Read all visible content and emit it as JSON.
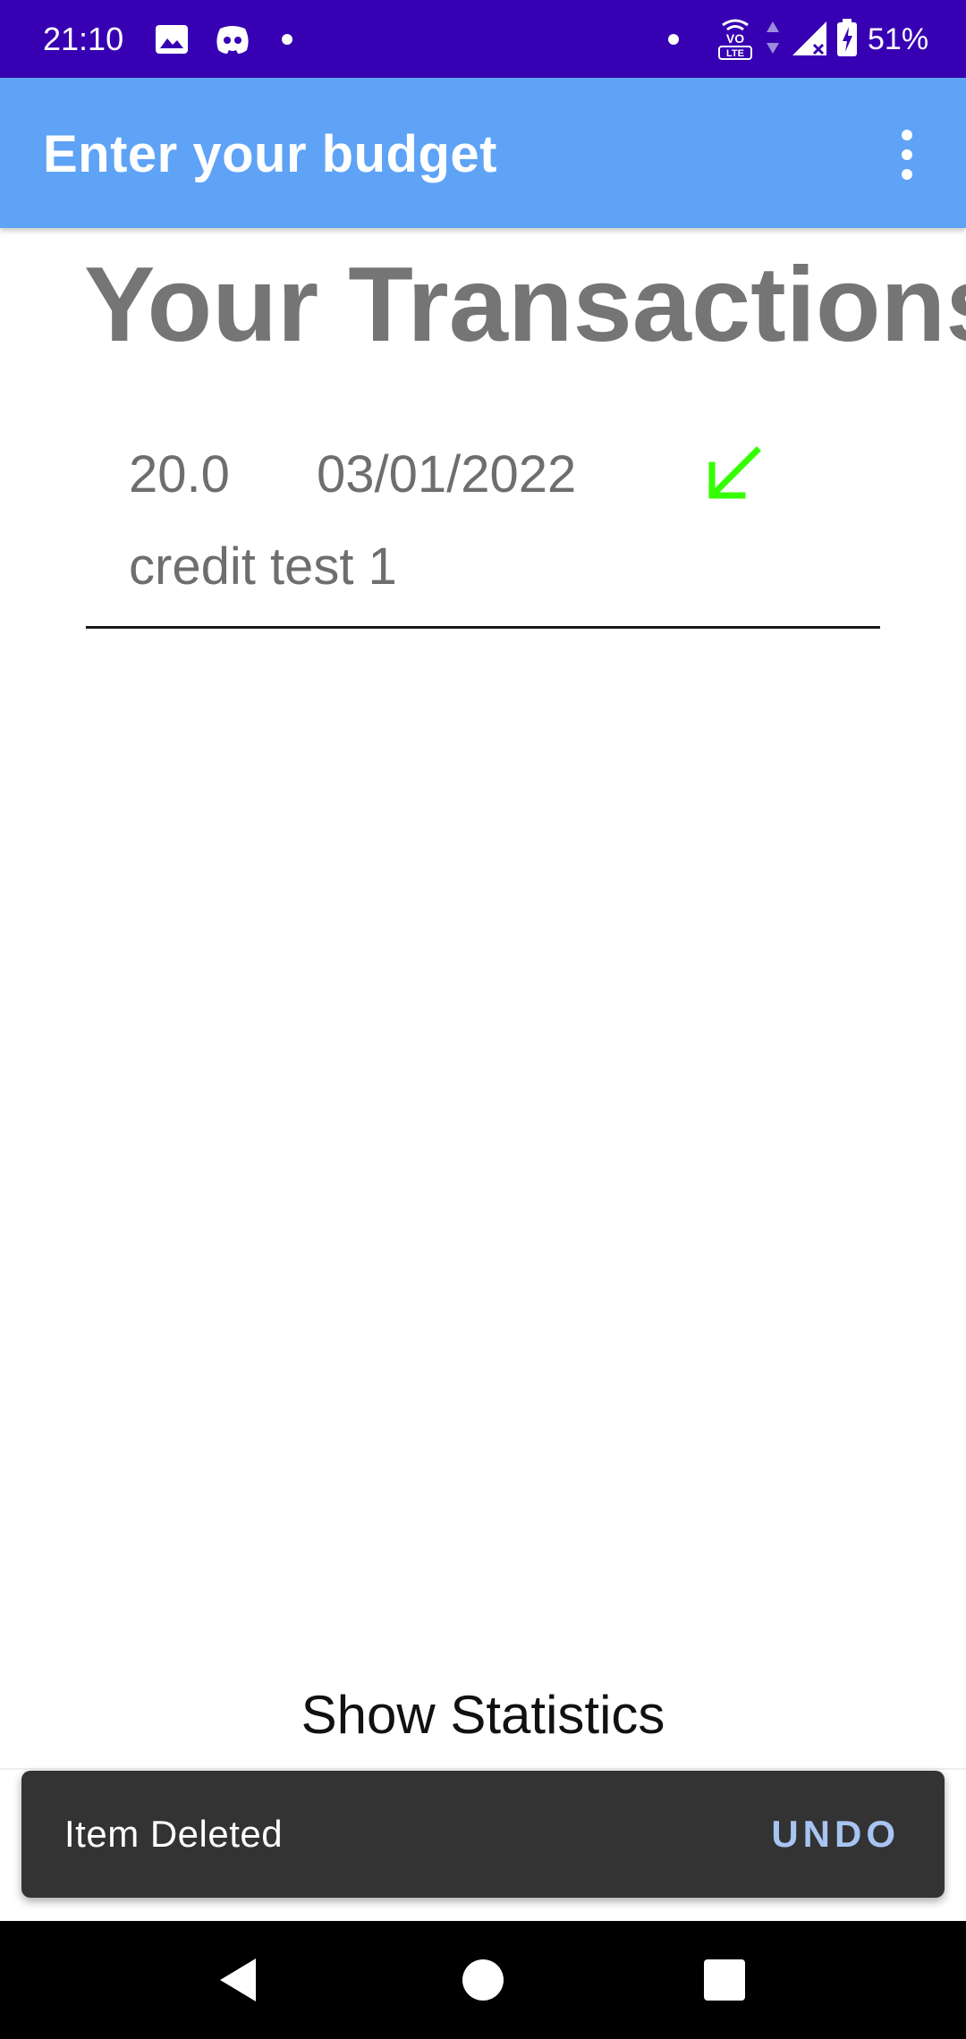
{
  "status_bar": {
    "time": "21:10",
    "battery": "51%",
    "icons": [
      "image-icon",
      "discord-icon",
      "notification-dot-icon",
      "dot-icon",
      "volte-icon",
      "data-arrows-icon",
      "signal-icon",
      "battery-charging-icon"
    ]
  },
  "app_bar": {
    "title": "Enter your budget",
    "menu_icon": "more-vert-icon"
  },
  "main": {
    "heading": "Your Transactions",
    "transactions": [
      {
        "amount": "20.0",
        "date": "03/01/2022",
        "description": "credit test 1",
        "type_icon": "arrow-down-left-icon",
        "type_color": "#33ff00"
      }
    ],
    "show_statistics_label": "Show Statistics"
  },
  "snackbar": {
    "message": "Item Deleted",
    "action_label": "UNDO"
  },
  "nav_bar": {
    "icons": [
      "back-icon",
      "home-icon",
      "recents-icon"
    ]
  },
  "colors": {
    "status_bar": "#3700b3",
    "app_bar": "#5fa3f6",
    "heading_text": "#757575",
    "credit_arrow": "#33ff00",
    "snackbar_bg": "#333333",
    "snackbar_action": "#a7c4f2"
  }
}
